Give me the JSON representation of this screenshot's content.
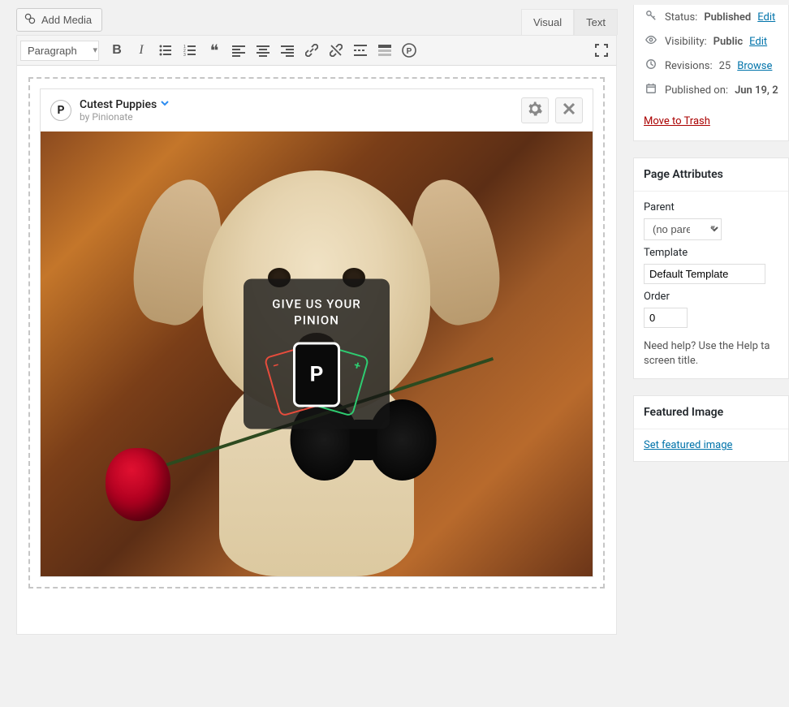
{
  "toolbar": {
    "add_media": "Add Media",
    "tab_visual": "Visual",
    "tab_text": "Text",
    "format_select": "Paragraph"
  },
  "embed": {
    "title": "Cutest Puppies",
    "author": "by Pinionate",
    "overlay_title": "GIVE US YOUR PINION",
    "card_minus": "−",
    "card_plus": "+",
    "card_p": "P"
  },
  "publish": {
    "status_label": "Status:",
    "status_value": "Published",
    "status_edit": "Edit",
    "visibility_label": "Visibility:",
    "visibility_value": "Public",
    "visibility_edit": "Edit",
    "revisions_label": "Revisions:",
    "revisions_value": "25",
    "revisions_browse": "Browse",
    "published_label": "Published on:",
    "published_value": "Jun 19, 2",
    "move_to_trash": "Move to Trash"
  },
  "page_attributes": {
    "box_title": "Page Attributes",
    "parent_label": "Parent",
    "parent_value": "(no parent)",
    "template_label": "Template",
    "template_value": "Default Template",
    "order_label": "Order",
    "order_value": "0",
    "help_text": "Need help? Use the Help ta screen title."
  },
  "featured_image": {
    "box_title": "Featured Image",
    "link": "Set featured image"
  }
}
